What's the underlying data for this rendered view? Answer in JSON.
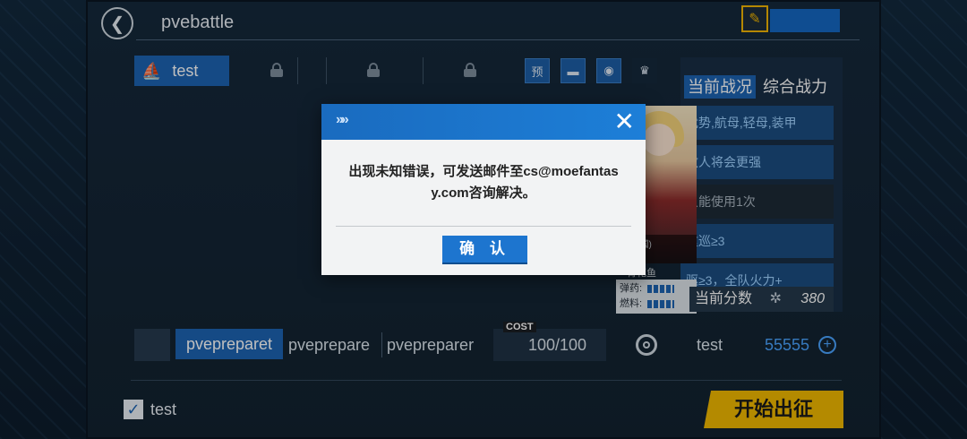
{
  "header": {
    "title": "pvebattle",
    "back_label": "❮"
  },
  "tabs": {
    "active_label": "test",
    "mode_icons": [
      "preview-icon",
      "book-icon",
      "medal-icon",
      "trophy-icon"
    ],
    "mode_icon_1_text": "预"
  },
  "right_panel": {
    "tab_current": "当前战况",
    "tab_power": "综合战力",
    "rows": [
      "优势,航母,轻母,装甲",
      "敌人将会更强",
      "只能使用1次",
      "重巡≥3",
      "驱≥3，全队火力+"
    ],
    "char_meta": "(U国)",
    "char_name": "青花鱼",
    "ammo_label": "弹药:",
    "fuel_label": "燃料:",
    "score_label": "当前分数",
    "score_value": "380"
  },
  "bottom_bar": {
    "items": [
      "pvepreparet",
      "pveprepare",
      "pvepreparer"
    ],
    "cost_tag": "COST",
    "cost_value": "100/100",
    "fleet_label": "test",
    "coins": "55555"
  },
  "footer": {
    "checkbox_label": "test",
    "start_button": "开始出征"
  },
  "dialog": {
    "chevrons": "»»",
    "close": "✕",
    "message_line1": "出现未知错误，可发送邮件至cs@moefantas",
    "message_line2": "y.com咨询解决。",
    "ok_button": "确 认"
  },
  "colors": {
    "accent": "#1d63b2",
    "start_button": "#f1b800",
    "coins": "#4aa3ff"
  }
}
